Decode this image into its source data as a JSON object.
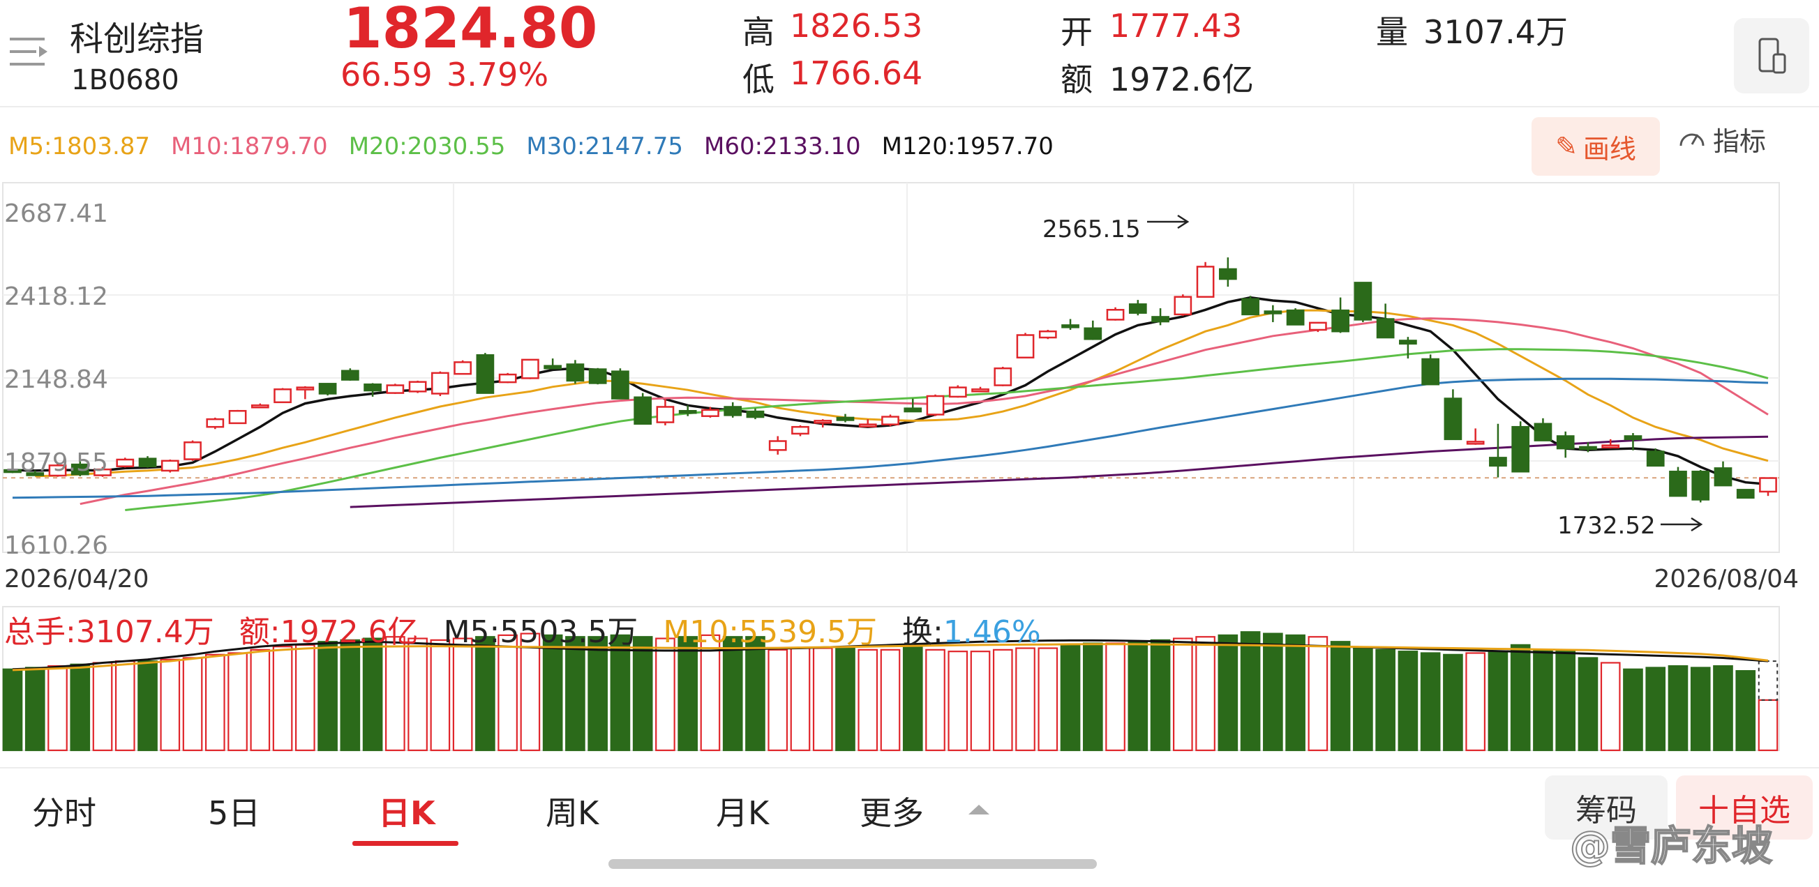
{
  "header": {
    "menu_icon": "menu-lines-icon",
    "name": "科创综指",
    "code": "1B0680",
    "price": "1824.80",
    "change": "66.59",
    "change_pct": "3.79%",
    "high_label": "高",
    "high": "1826.53",
    "low_label": "低",
    "low": "1766.64",
    "open_label": "开",
    "open": "1777.43",
    "amount_label": "额",
    "amount": "1972.6亿",
    "volume_label": "量",
    "volume": "3107.4万",
    "device_icon": "phone-rotate-icon"
  },
  "ma_legend": [
    {
      "label": "M5:1803.87",
      "color": "#111111"
    },
    {
      "label": "M10:1879.70",
      "color": "#e8a317"
    },
    {
      "label": "M20:2030.55",
      "color": "#e8607a"
    },
    {
      "label": "M30:2147.75",
      "color": "#5cbf47"
    },
    {
      "label": "M60:2133.10",
      "color": "#2f7ab8"
    },
    {
      "label": "M120:1957.70",
      "color": "#5a1060"
    }
  ],
  "toolbar": {
    "draw_label": "画线",
    "draw_icon": "pencil-icon",
    "indicator_label": "指标",
    "indicator_icon": "gauge-icon"
  },
  "chart_data": {
    "type": "candlestick",
    "ylim": [
      1610.26,
      2687.41
    ],
    "y_ticks": [
      "2687.41",
      "2418.12",
      "2148.84",
      "1879.55",
      "1610.26"
    ],
    "x_start_label": "2026/04/20",
    "x_end_label": "2026/08/04",
    "max_annotation": "2565.15",
    "min_annotation": "1732.52",
    "last_close": 1824.8,
    "candles": [
      [
        1850,
        1852,
        1840,
        1848
      ],
      [
        1840,
        1848,
        1835,
        1838
      ],
      [
        1832,
        1870,
        1828,
        1865
      ],
      [
        1868,
        1878,
        1830,
        1836
      ],
      [
        1833,
        1860,
        1828,
        1852
      ],
      [
        1862,
        1890,
        1858,
        1884
      ],
      [
        1887,
        1895,
        1858,
        1862
      ],
      [
        1848,
        1884,
        1842,
        1880
      ],
      [
        1885,
        1946,
        1880,
        1940
      ],
      [
        1990,
        2020,
        1983,
        2015
      ],
      [
        2002,
        2045,
        2000,
        2042
      ],
      [
        2060,
        2066,
        2052,
        2060
      ],
      [
        2070,
        2116,
        2068,
        2112
      ],
      [
        2112,
        2122,
        2080,
        2118
      ],
      [
        2130,
        2132,
        2092,
        2098
      ],
      [
        2172,
        2180,
        2140,
        2143
      ],
      [
        2128,
        2132,
        2088,
        2108
      ],
      [
        2100,
        2130,
        2097,
        2125
      ],
      [
        2105,
        2140,
        2100,
        2136
      ],
      [
        2098,
        2170,
        2090,
        2165
      ],
      [
        2162,
        2206,
        2160,
        2200
      ],
      [
        2223,
        2230,
        2100,
        2100
      ],
      [
        2135,
        2165,
        2132,
        2160
      ],
      [
        2148,
        2210,
        2145,
        2208
      ],
      [
        2188,
        2212,
        2178,
        2180
      ],
      [
        2193,
        2207,
        2130,
        2140
      ],
      [
        2177,
        2181,
        2128,
        2132
      ],
      [
        2170,
        2180,
        2085,
        2082
      ],
      [
        2086,
        2100,
        2005,
        2000
      ],
      [
        2005,
        2080,
        1995,
        2055
      ],
      [
        2042,
        2060,
        2025,
        2040
      ],
      [
        2025,
        2055,
        2020,
        2045
      ],
      [
        2055,
        2070,
        2020,
        2028
      ],
      [
        2040,
        2050,
        2015,
        2022
      ],
      [
        1915,
        1960,
        1900,
        1944
      ],
      [
        1968,
        1995,
        1960,
        1990
      ],
      [
        2005,
        2015,
        1988,
        2010
      ],
      [
        2020,
        2032,
        2005,
        2012
      ],
      [
        1998,
        2015,
        1990,
        1998
      ],
      [
        1998,
        2030,
        1992,
        2023
      ],
      [
        2050,
        2082,
        2050,
        2040
      ],
      [
        2030,
        2095,
        2025,
        2090
      ],
      [
        2088,
        2125,
        2085,
        2118
      ],
      [
        2108,
        2120,
        2106,
        2112
      ],
      [
        2125,
        2185,
        2122,
        2180
      ],
      [
        2215,
        2295,
        2213,
        2288
      ],
      [
        2280,
        2305,
        2275,
        2300
      ],
      [
        2320,
        2340,
        2305,
        2316
      ],
      [
        2310,
        2335,
        2272,
        2275
      ],
      [
        2338,
        2378,
        2335,
        2370
      ],
      [
        2388,
        2402,
        2352,
        2360
      ],
      [
        2347,
        2375,
        2320,
        2332
      ],
      [
        2355,
        2420,
        2350,
        2412
      ],
      [
        2412,
        2525,
        2410,
        2510
      ],
      [
        2502,
        2540,
        2445,
        2470
      ],
      [
        2405,
        2415,
        2365,
        2355
      ],
      [
        2365,
        2385,
        2330,
        2360
      ],
      [
        2368,
        2375,
        2320,
        2322
      ],
      [
        2305,
        2330,
        2298,
        2328
      ],
      [
        2368,
        2410,
        2295,
        2300
      ],
      [
        2458,
        2460,
        2330,
        2338
      ],
      [
        2340,
        2390,
        2280,
        2280
      ],
      [
        2270,
        2282,
        2212,
        2260
      ],
      [
        2210,
        2225,
        2144,
        2128
      ],
      [
        2082,
        2112,
        1968,
        1950
      ],
      [
        1942,
        1985,
        1932,
        1942
      ],
      [
        1890,
        2000,
        1826,
        1864
      ],
      [
        1990,
        2008,
        1850,
        1845
      ],
      [
        2000,
        2018,
        1950,
        1946
      ],
      [
        1960,
        1975,
        1890,
        1920
      ],
      [
        1925,
        1940,
        1908,
        1922
      ],
      [
        1928,
        1950,
        1920,
        1930
      ],
      [
        1960,
        1970,
        1914,
        1950
      ],
      [
        1910,
        1920,
        1876,
        1864
      ],
      [
        1845,
        1860,
        1772,
        1766
      ],
      [
        1845,
        1850,
        1745,
        1754
      ],
      [
        1856,
        1878,
        1850,
        1800
      ],
      [
        1786,
        1780,
        1762,
        1760
      ],
      [
        1780,
        1826,
        1766,
        1824
      ]
    ],
    "ma_series": [
      {
        "name": "M5",
        "values": [
          1850,
          1848,
          1850,
          1850,
          1848,
          1856,
          1858,
          1862,
          1874,
          1910,
          1950,
          1990,
          2035,
          2066,
          2080,
          2090,
          2098,
          2106,
          2110,
          2115,
          2125,
          2133,
          2140,
          2160,
          2175,
          2180,
          2175,
          2150,
          2110,
          2080,
          2060,
          2050,
          2044,
          2036,
          2020,
          2010,
          2000,
          1995,
          1990,
          1995,
          2008,
          2030,
          2050,
          2070,
          2095,
          2125,
          2170,
          2210,
          2250,
          2290,
          2320,
          2334,
          2348,
          2370,
          2395,
          2410,
          2400,
          2395,
          2375,
          2355,
          2350,
          2340,
          2320,
          2300,
          2240,
          2160,
          2080,
          2020,
          1960,
          1920,
          1915,
          1918,
          1920,
          1915,
          1895,
          1860,
          1830,
          1810,
          1804
        ]
      },
      {
        "name": "M10",
        "values": [
          null,
          1830,
          1832,
          1836,
          1840,
          1845,
          1848,
          1853,
          1858,
          1870,
          1885,
          1902,
          1922,
          1940,
          1960,
          1980,
          2000,
          2020,
          2038,
          2056,
          2070,
          2085,
          2095,
          2105,
          2120,
          2130,
          2140,
          2138,
          2130,
          2120,
          2110,
          2096,
          2083,
          2070,
          2052,
          2040,
          2030,
          2020,
          2015,
          2012,
          2010,
          2012,
          2015,
          2025,
          2040,
          2060,
          2085,
          2110,
          2140,
          2170,
          2205,
          2240,
          2270,
          2300,
          2320,
          2345,
          2360,
          2368,
          2368,
          2365,
          2365,
          2360,
          2350,
          2335,
          2320,
          2295,
          2260,
          2220,
          2180,
          2140,
          2095,
          2060,
          2020,
          1990,
          1968,
          1948,
          1920,
          1900,
          1880
        ]
      },
      {
        "name": "M20",
        "values": [
          null,
          null,
          null,
          1740,
          1755,
          1770,
          1782,
          1795,
          1808,
          1822,
          1838,
          1855,
          1872,
          1888,
          1905,
          1922,
          1938,
          1955,
          1970,
          1985,
          2000,
          2012,
          2025,
          2037,
          2048,
          2058,
          2068,
          2075,
          2080,
          2083,
          2085,
          2084,
          2082,
          2080,
          2078,
          2076,
          2074,
          2072,
          2070,
          2068,
          2066,
          2064,
          2066,
          2072,
          2080,
          2090,
          2105,
          2120,
          2140,
          2160,
          2180,
          2200,
          2220,
          2240,
          2255,
          2270,
          2285,
          2295,
          2305,
          2315,
          2325,
          2335,
          2340,
          2342,
          2340,
          2336,
          2330,
          2322,
          2312,
          2300,
          2282,
          2265,
          2245,
          2220,
          2195,
          2165,
          2120,
          2075,
          2030
        ]
      },
      {
        "name": "M30",
        "values": [
          null,
          null,
          null,
          null,
          null,
          1720,
          1728,
          1735,
          1742,
          1750,
          1758,
          1768,
          1780,
          1795,
          1810,
          1826,
          1842,
          1858,
          1874,
          1890,
          1905,
          1920,
          1935,
          1950,
          1965,
          1980,
          1995,
          2008,
          2018,
          2026,
          2034,
          2040,
          2046,
          2052,
          2058,
          2063,
          2068,
          2072,
          2076,
          2080,
          2084,
          2088,
          2092,
          2096,
          2100,
          2106,
          2112,
          2118,
          2124,
          2130,
          2136,
          2142,
          2148,
          2156,
          2164,
          2172,
          2180,
          2188,
          2195,
          2202,
          2210,
          2218,
          2226,
          2232,
          2238,
          2240,
          2242,
          2242,
          2241,
          2240,
          2238,
          2234,
          2228,
          2220,
          2210,
          2198,
          2184,
          2168,
          2148
        ]
      },
      {
        "name": "M60",
        "values": [
          1760,
          1761,
          1762,
          1763,
          1764,
          1765,
          1766,
          1768,
          1770,
          1772,
          1774,
          1776,
          1779,
          1782,
          1785,
          1788,
          1791,
          1794,
          1797,
          1800,
          1803,
          1806,
          1809,
          1812,
          1815,
          1818,
          1821,
          1824,
          1827,
          1830,
          1833,
          1836,
          1839,
          1842,
          1845,
          1848,
          1851,
          1855,
          1860,
          1866,
          1872,
          1880,
          1888,
          1896,
          1905,
          1915,
          1926,
          1938,
          1950,
          1962,
          1975,
          1988,
          2000,
          2012,
          2024,
          2036,
          2048,
          2060,
          2072,
          2084,
          2096,
          2108,
          2120,
          2130,
          2136,
          2140,
          2142,
          2144,
          2145,
          2146,
          2146,
          2146,
          2145,
          2144,
          2142,
          2140,
          2138,
          2135,
          2133
        ]
      },
      {
        "name": "M120",
        "values": [
          null,
          null,
          null,
          null,
          null,
          null,
          null,
          null,
          null,
          null,
          null,
          null,
          null,
          null,
          null,
          1730,
          1733,
          1736,
          1739,
          1742,
          1745,
          1748,
          1751,
          1754,
          1757,
          1760,
          1763,
          1766,
          1769,
          1772,
          1775,
          1778,
          1781,
          1784,
          1787,
          1790,
          1793,
          1796,
          1799,
          1802,
          1805,
          1808,
          1811,
          1814,
          1817,
          1820,
          1823,
          1826,
          1830,
          1834,
          1838,
          1843,
          1848,
          1854,
          1860,
          1866,
          1872,
          1878,
          1884,
          1890,
          1895,
          1900,
          1905,
          1910,
          1914,
          1918,
          1922,
          1926,
          1930,
          1934,
          1938,
          1942,
          1946,
          1950,
          1953,
          1955,
          1956,
          1957,
          1958
        ]
      }
    ],
    "volume": {
      "total_label": "总手:3107.4万",
      "amount_label": "额:1972.6亿",
      "m5_label": "M5:5503.5万",
      "m10_label": "M10:5539.5万",
      "turnover_prefix": "换:",
      "turnover_value": "1.46%",
      "values": [
        5000,
        5100,
        5200,
        5300,
        5400,
        5500,
        5500,
        5600,
        5700,
        5900,
        6000,
        6200,
        6400,
        6500,
        6700,
        6800,
        6900,
        7000,
        6900,
        6800,
        6900,
        7000,
        7100,
        7200,
        7100,
        7000,
        7000,
        7100,
        7000,
        6900,
        7000,
        7100,
        7000,
        7000,
        6200,
        6300,
        6300,
        6300,
        6200,
        6200,
        6400,
        6200,
        6100,
        6100,
        6200,
        6300,
        6300,
        6500,
        6600,
        6600,
        6700,
        6800,
        6900,
        7000,
        7100,
        7300,
        7200,
        7100,
        7000,
        6700,
        6300,
        6200,
        6100,
        6000,
        5900,
        6000,
        6100,
        6500,
        6200,
        6100,
        5700,
        5400,
        5000,
        5100,
        5200,
        5100,
        5200,
        4900,
        3100
      ],
      "m5": [
        5000,
        5050,
        5150,
        5250,
        5400,
        5500,
        5600,
        5750,
        5900,
        6100,
        6250,
        6400,
        6500,
        6550,
        6600,
        6650,
        6700,
        6650,
        6600,
        6550,
        6500,
        6450,
        6400,
        6350,
        6300,
        6250,
        6200,
        6180,
        6160,
        6150,
        6150,
        6150,
        6200,
        6250,
        6280,
        6300,
        6350,
        6400,
        6450,
        6500,
        6550,
        6600,
        6650,
        6700,
        6720,
        6750,
        6770,
        6780,
        6780,
        6770,
        6750,
        6720,
        6680,
        6640,
        6600,
        6560,
        6520,
        6480,
        6440,
        6400,
        6360,
        6320,
        6280,
        6240,
        6200,
        6160,
        6120,
        6080,
        6040,
        6000,
        5960,
        5920,
        5880,
        5840,
        5800,
        5760,
        5700,
        5600,
        5500
      ],
      "m10": [
        4950,
        5000,
        5050,
        5100,
        5200,
        5300,
        5400,
        5500,
        5650,
        5800,
        5950,
        6100,
        6200,
        6280,
        6340,
        6380,
        6400,
        6410,
        6420,
        6420,
        6410,
        6400,
        6390,
        6380,
        6370,
        6360,
        6350,
        6340,
        6330,
        6320,
        6310,
        6300,
        6300,
        6310,
        6320,
        6340,
        6360,
        6380,
        6400,
        6420,
        6440,
        6460,
        6480,
        6500,
        6510,
        6520,
        6530,
        6540,
        6545,
        6545,
        6540,
        6530,
        6520,
        6510,
        6500,
        6480,
        6460,
        6440,
        6420,
        6400,
        6380,
        6360,
        6340,
        6320,
        6300,
        6280,
        6260,
        6240,
        6220,
        6200,
        6180,
        6140,
        6100,
        6050,
        6000,
        5950,
        5850,
        5700,
        5540
      ]
    }
  },
  "tabs": [
    "分时",
    "5日",
    "日K",
    "周K",
    "月K",
    "更多"
  ],
  "active_tab": "日K",
  "bottom_buttons": {
    "chips": "筹码",
    "watchlist": "十自选"
  },
  "watermark": "@雪庐东坡"
}
